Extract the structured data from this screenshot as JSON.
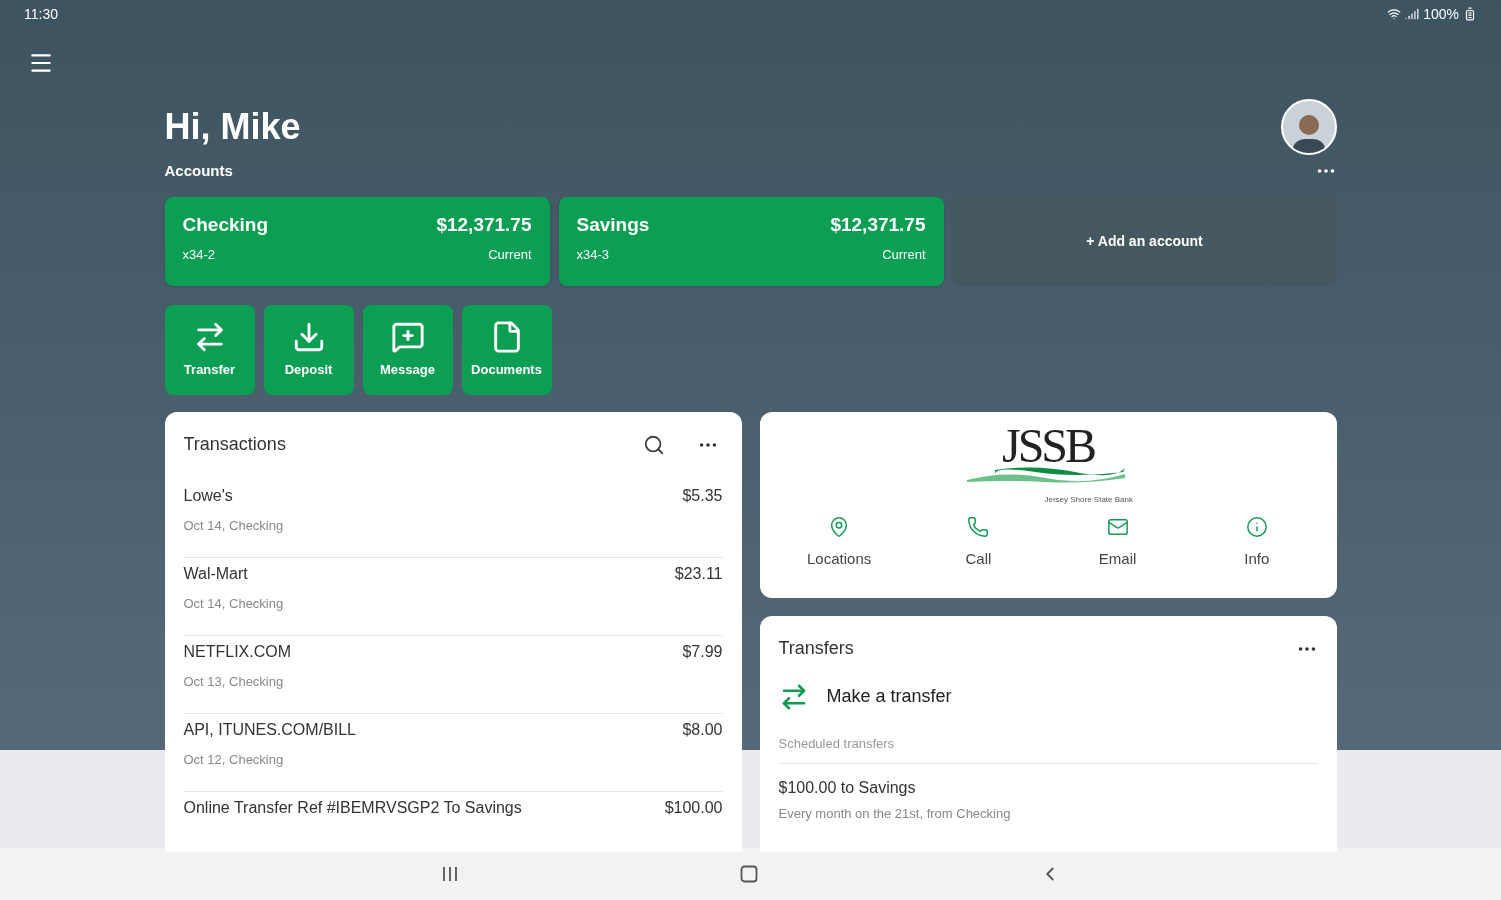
{
  "status_bar": {
    "time": "11:30",
    "battery": "100%"
  },
  "greeting": "Hi, Mike",
  "accounts_label": "Accounts",
  "accounts": [
    {
      "name": "Checking",
      "number": "x34-2",
      "balance": "$12,371.75",
      "balance_type": "Current"
    },
    {
      "name": "Savings",
      "number": "x34-3",
      "balance": "$12,371.75",
      "balance_type": "Current"
    }
  ],
  "add_account": "+ Add an account",
  "actions": [
    {
      "kind": "transfer",
      "label": "Transfer"
    },
    {
      "kind": "deposit",
      "label": "Deposit"
    },
    {
      "kind": "message",
      "label": "Message"
    },
    {
      "kind": "documents",
      "label": "Documents"
    }
  ],
  "transactions": {
    "title": "Transactions",
    "rows": [
      {
        "name": "Lowe's",
        "detail": "Oct 14, Checking",
        "amount": "$5.35"
      },
      {
        "name": "Wal-Mart",
        "detail": "Oct 14, Checking",
        "amount": "$23.11"
      },
      {
        "name": "NETFLIX.COM",
        "detail": "Oct 13, Checking",
        "amount": "$7.99"
      },
      {
        "name": "API, ITUNES.COM/BILL",
        "detail": "Oct 12, Checking",
        "amount": "$8.00"
      },
      {
        "name": "Online Transfer Ref #IBEMRVSGP2 To Savings",
        "amount": "$100.00"
      }
    ]
  },
  "bank": {
    "logo": "JSSB",
    "tagline": "Jersey Shore State Bank",
    "links": [
      {
        "kind": "location",
        "label": "Locations"
      },
      {
        "kind": "call",
        "label": "Call"
      },
      {
        "kind": "email",
        "label": "Email"
      },
      {
        "kind": "info",
        "label": "Info"
      }
    ]
  },
  "transfers": {
    "title": "Transfers",
    "make": "Make a transfer",
    "scheduled_label": "Scheduled transfers",
    "scheduled": [
      {
        "title": "$100.00 to Savings",
        "detail": "Every month on the 21st, from Checking"
      }
    ]
  }
}
